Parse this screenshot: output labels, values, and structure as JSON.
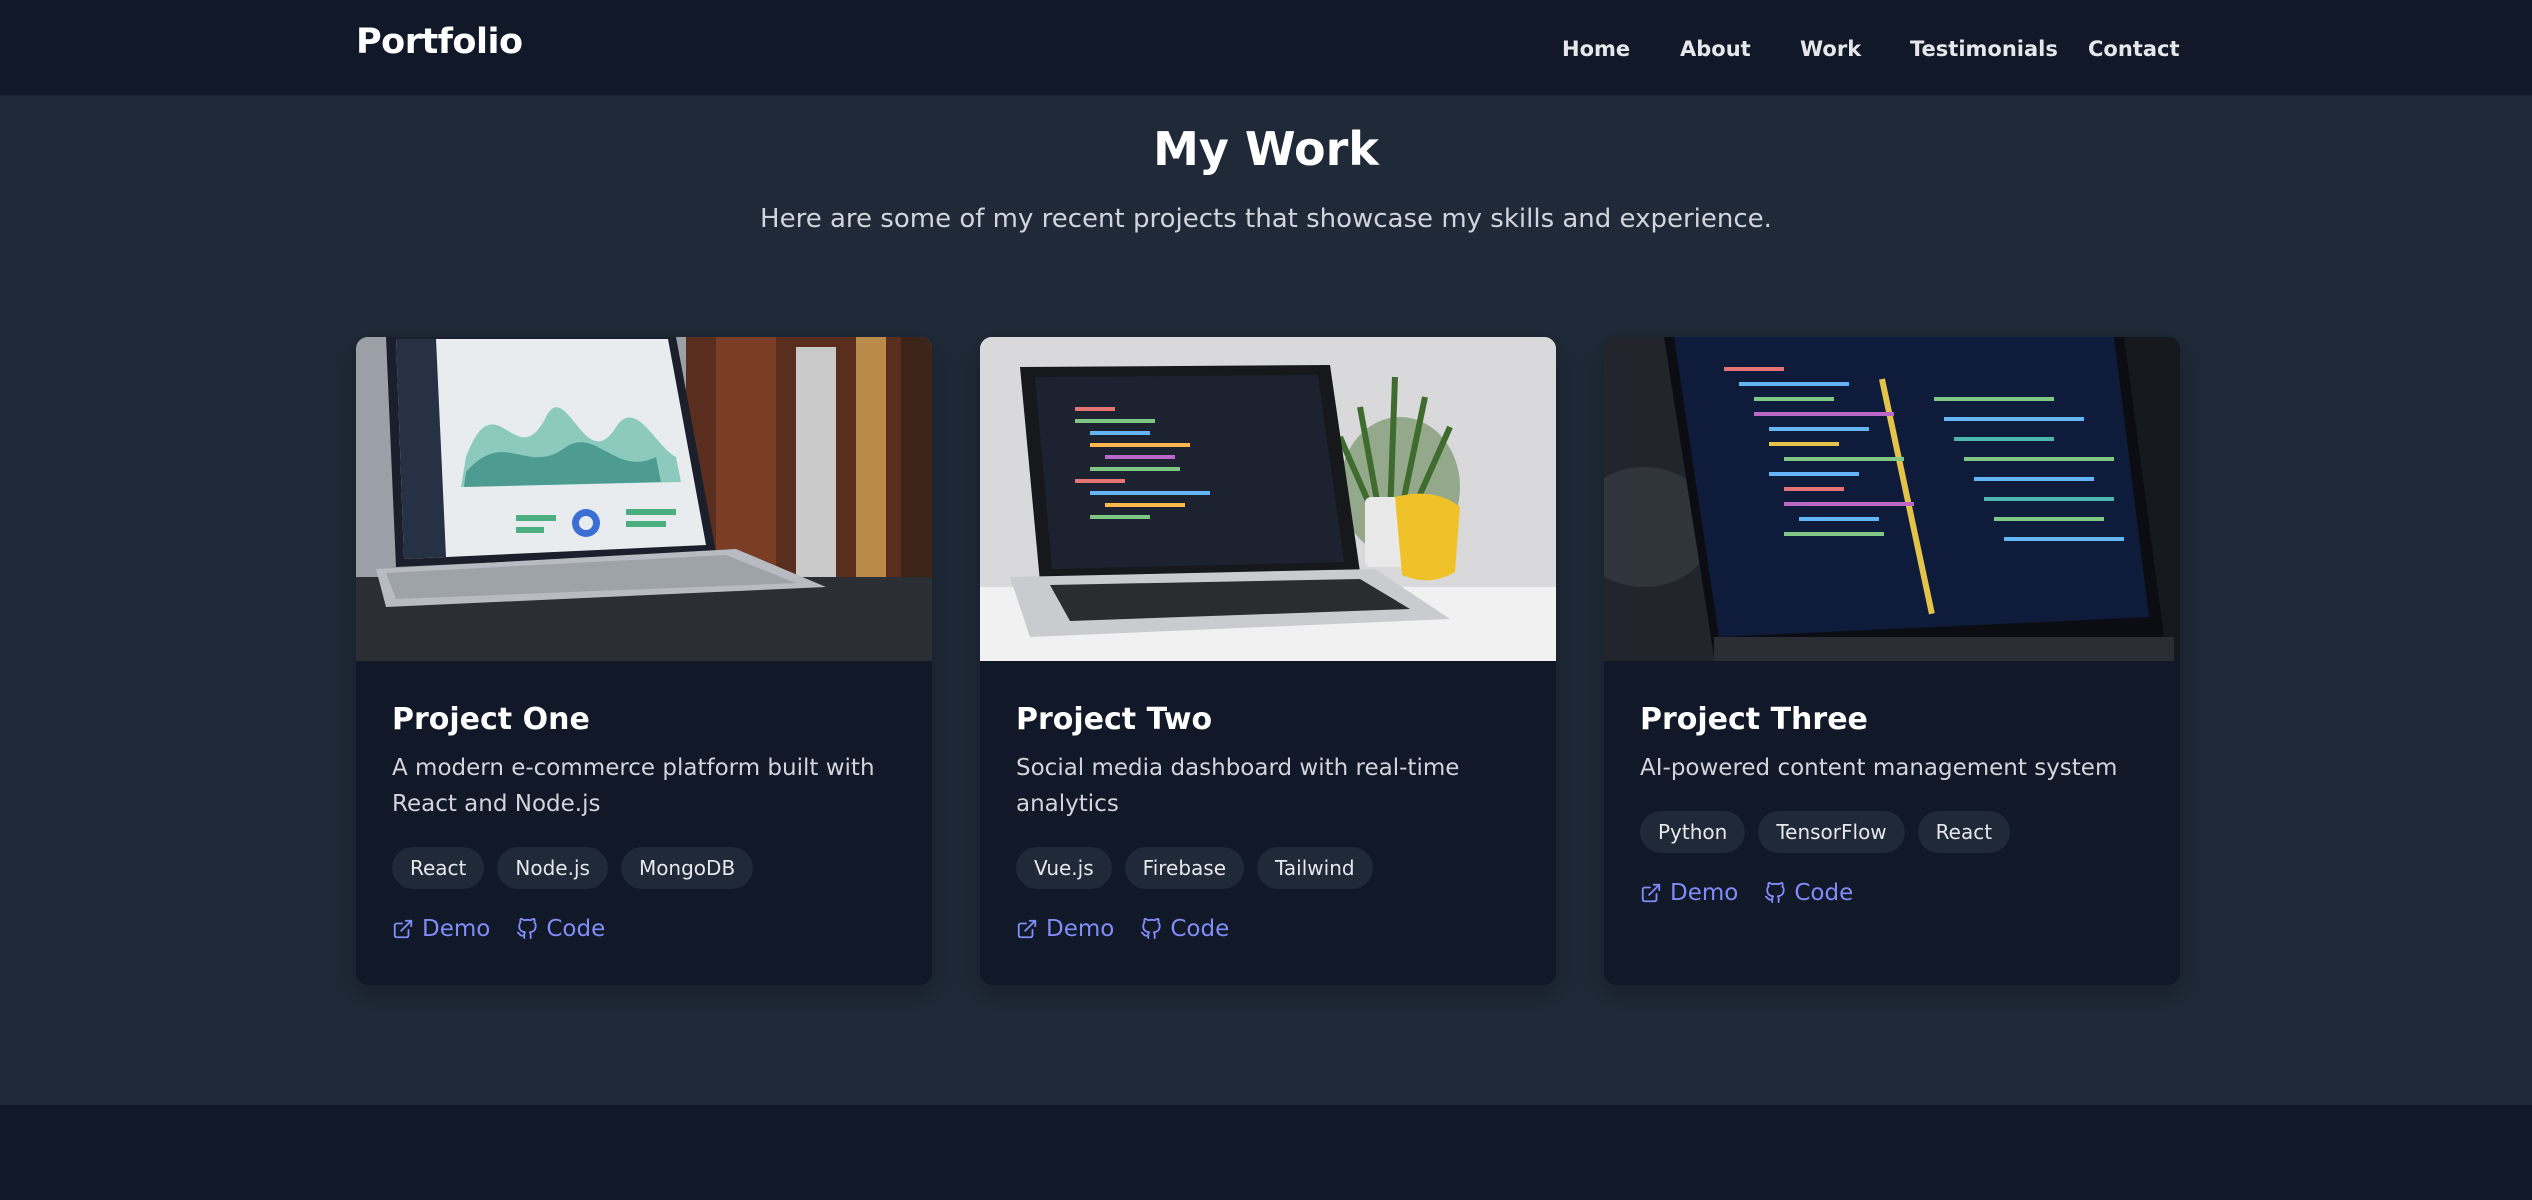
{
  "nav": {
    "brand": "Portfolio",
    "links": [
      "Home",
      "About",
      "Work",
      "Testimonials",
      "Contact"
    ]
  },
  "work": {
    "title": "My Work",
    "subtitle": "Here are some of my recent projects that showcase my skills and experience."
  },
  "projects": [
    {
      "title": "Project One",
      "description": "A modern e-commerce platform built with React and Node.js",
      "tags": [
        "React",
        "Node.js",
        "MongoDB"
      ],
      "demo_label": "Demo",
      "code_label": "Code",
      "image_alt": "laptop showing analytics dashboard"
    },
    {
      "title": "Project Two",
      "description": "Social media dashboard with real-time analytics",
      "tags": [
        "Vue.js",
        "Firebase",
        "Tailwind"
      ],
      "demo_label": "Demo",
      "code_label": "Code",
      "image_alt": "laptop with code editor beside plant and yellow mug"
    },
    {
      "title": "Project Three",
      "description": "AI-powered content management system",
      "tags": [
        "Python",
        "TensorFlow",
        "React"
      ],
      "demo_label": "Demo",
      "code_label": "Code",
      "image_alt": "laptop showing dark code editor"
    }
  ],
  "icons": {
    "demo": "external-link-icon",
    "code": "github-icon"
  },
  "colors": {
    "background": "#1f2937",
    "navbar": "#111827",
    "card": "#111827",
    "accent": "#818cf8",
    "tag_bg": "#1f2937"
  }
}
